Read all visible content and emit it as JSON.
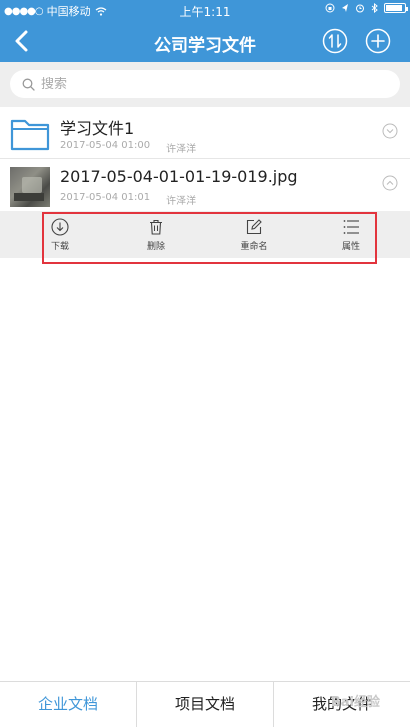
{
  "status_bar": {
    "carrier": "中国移动",
    "time": "上午1:11"
  },
  "nav": {
    "title": "公司学习文件"
  },
  "search": {
    "placeholder": "搜索"
  },
  "files": [
    {
      "name": "学习文件1",
      "date": "2017-05-04 01:00",
      "owner": "许泽洋",
      "type": "folder"
    },
    {
      "name": "2017-05-04-01-01-19-019.jpg",
      "date": "2017-05-04 01:01",
      "owner": "许泽洋",
      "type": "image"
    }
  ],
  "actions": {
    "download": "下载",
    "delete": "删除",
    "rename": "重命名",
    "properties": "属性"
  },
  "tabs": [
    {
      "label": "企业文档",
      "active": true
    },
    {
      "label": "项目文档",
      "active": false
    },
    {
      "label": "我的文件",
      "active": false
    }
  ],
  "watermark": "Bai经验",
  "colors": {
    "brand_blue": "#3f96d8",
    "highlight_red": "#e2343d"
  }
}
